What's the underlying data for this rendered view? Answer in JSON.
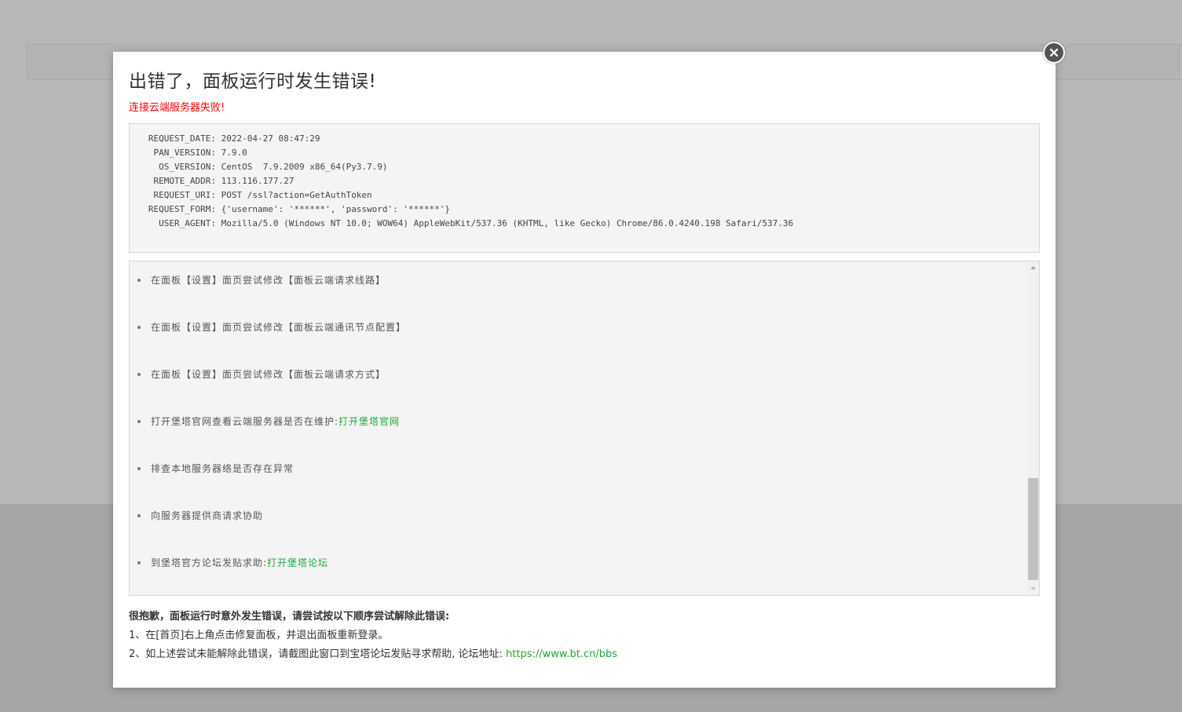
{
  "dialog": {
    "title": "出错了，面板运行时发生错误!",
    "subtitle": "连接云端服务器失败!",
    "info": [
      {
        "key": "REQUEST_DATE:",
        "value": "2022-04-27 08:47:29"
      },
      {
        "key": "PAN_VERSION:",
        "value": "7.9.0"
      },
      {
        "key": "OS_VERSION:",
        "value": "CentOS  7.9.2009 x86_64(Py3.7.9)"
      },
      {
        "key": "REMOTE_ADDR:",
        "value": "113.116.177.27"
      },
      {
        "key": "REQUEST_URI:",
        "value": "POST /ssl?action=GetAuthToken"
      },
      {
        "key": "REQUEST_FORM:",
        "value": "{'username': '******', 'password': '******'}"
      },
      {
        "key": "USER_AGENT:",
        "value": "Mozilla/5.0 (Windows NT 10.0; WOW64) AppleWebKit/537.36 (KHTML, like Gecko) Chrome/86.0.4240.198 Safari/537.36"
      }
    ],
    "help_items": [
      {
        "text": "在面板【设置】面页尝试修改【面板云端请求线路】",
        "link": ""
      },
      {
        "text": "在面板【设置】面页尝试修改【面板云端通讯节点配置】",
        "link": ""
      },
      {
        "text": "在面板【设置】面页尝试修改【面板云端请求方式】",
        "link": ""
      },
      {
        "text": "打开堡塔官网查看云端服务器是否在维护:",
        "link": "打开堡塔官网"
      },
      {
        "text": "排查本地服务器络是否存在异常",
        "link": ""
      },
      {
        "text": "向服务器提供商请求协助",
        "link": ""
      },
      {
        "text": "到堡塔官方论坛发贴求助:",
        "link": "打开堡塔论坛"
      }
    ],
    "footer": {
      "heading": "很抱歉，面板运行时意外发生错误，请尝试按以下顺序尝试解除此错误:",
      "line1": "1、在[首页]右上角点击修复面板，并退出面板重新登录。",
      "line2": "2、如上述尝试未能解除此错误，请截图此窗口到宝塔论坛发贴寻求帮助, 论坛地址:",
      "forum_url": "https://www.bt.cn/bbs"
    }
  },
  "colors": {
    "error_red": "#ff0000",
    "link_green": "#20a53a",
    "overlay_gray": "#b7b7b7"
  },
  "icons": {
    "close": "close-icon",
    "scroll_up": "arrow-up-icon",
    "scroll_down": "arrow-down-icon"
  }
}
